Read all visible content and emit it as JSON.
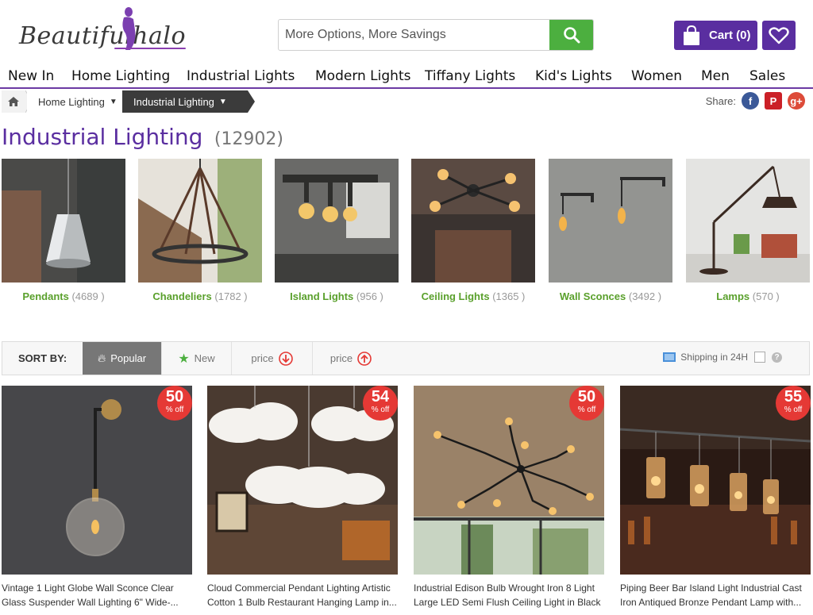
{
  "brand": {
    "logo_text": "Beautifulhalo"
  },
  "search": {
    "placeholder": "More Options, More Savings"
  },
  "cart": {
    "label": "Cart (0)"
  },
  "nav": {
    "items": [
      "New In",
      "Home Lighting",
      "Industrial Lights",
      "Modern Lights",
      "Tiffany Lights",
      "Kid's Lights",
      "Women",
      "Men",
      "Sales"
    ]
  },
  "breadcrumb": {
    "items": [
      "Home Lighting",
      "Industrial Lighting"
    ]
  },
  "share": {
    "label": "Share:",
    "networks": [
      "facebook-icon",
      "pinterest-icon",
      "google-plus-icon"
    ]
  },
  "page": {
    "title": "Industrial Lighting",
    "count": "(12902)"
  },
  "categories": [
    {
      "name": "Pendants",
      "count": "(4689 )"
    },
    {
      "name": "Chandeliers",
      "count": "(1782 )"
    },
    {
      "name": "Island Lights",
      "count": "(956 )"
    },
    {
      "name": "Ceiling Lights",
      "count": "(1365 )"
    },
    {
      "name": "Wall Sconces",
      "count": "(3492 )"
    },
    {
      "name": "Lamps",
      "count": "(570 )"
    }
  ],
  "sort": {
    "label": "SORT BY:",
    "options": [
      "Popular",
      "New",
      "price",
      "price"
    ],
    "active": "Popular",
    "shipping_label": "Shipping in 24H"
  },
  "products": [
    {
      "discount": "50",
      "off": "% off",
      "name": "Vintage 1 Light Globe Wall Sconce Clear Glass Suspender Wall Lighting 6\" Wide-..."
    },
    {
      "discount": "54",
      "off": "% off",
      "name": "Cloud Commercial Pendant Lighting Artistic Cotton 1 Bulb Restaurant Hanging Lamp in..."
    },
    {
      "discount": "50",
      "off": "% off",
      "name": "Industrial Edison Bulb Wrought Iron 8 Light Large LED Semi Flush Ceiling Light in Black"
    },
    {
      "discount": "55",
      "off": "% off",
      "name": "Piping Beer Bar Island Light Industrial Cast Iron Antiqued Bronze Pendant Lamp with..."
    }
  ],
  "colors": {
    "brand_purple": "#5a2ea0",
    "search_green": "#4caf3f",
    "category_green": "#5aa02c",
    "badge_red": "#e53935"
  }
}
